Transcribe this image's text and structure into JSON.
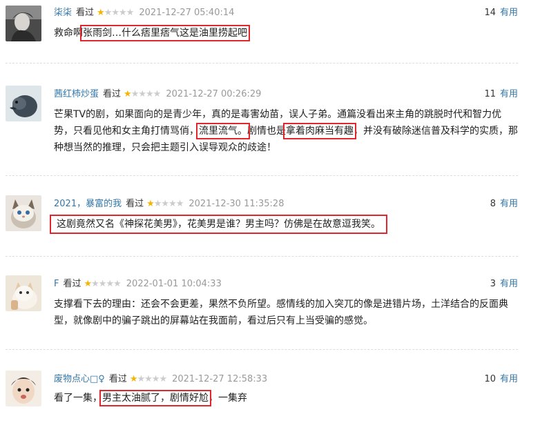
{
  "watched_label": "看过",
  "useful_label": "有用",
  "colors": {
    "link": "#3377aa",
    "star_on": "#f5b400",
    "star_off": "#cccccc",
    "highlight": "#e0262d"
  },
  "comments": [
    {
      "user": "柒柒",
      "stars": 1,
      "time": "2021-12-27 05:40:14",
      "votes": "14",
      "text_parts": [
        "救命啊",
        "张雨剑…什么痞里痞气这是油里捞起吧",
        ""
      ]
    },
    {
      "user": "茜红柿炒蛋",
      "stars": 1,
      "time": "2021-12-27 00:26:29",
      "votes": "11",
      "text_parts": [
        "芒果TV的剧，如果面向的是青少年，真的是毒害幼苗，误人子弟。通篇没看出来主角的跳脱时代和智力优势，只看见他和女主角打情骂俏，",
        "流里流气。",
        "剧情也是",
        "拿着肉麻当有趣",
        "，并没有破除迷信普及科学的实质，那种想当然的推理，只会把主题引入误导观众的歧途！"
      ]
    },
    {
      "user": "2021，暴富的我",
      "stars": 1,
      "time": "2021-12-30 11:35:28",
      "votes": "8",
      "text_parts": [
        "",
        "这剧竟然又名《神探花美男》，花美男是谁？男主吗？仿佛是在故意逗我笑。",
        ""
      ]
    },
    {
      "user": "F",
      "stars": 1,
      "time": "2022-01-01 10:04:33",
      "votes": "3",
      "text_parts": [
        "支撑看下去的理由：还会不会更差，果然不负所望。感情线的加入突兀的像是进错片场，土洋结合的反面典型，就像剧中的骗子跳出的屏幕站在我面前，看过后只有上当受骗的感觉。"
      ]
    },
    {
      "user": "废物点心□♀",
      "stars": 1,
      "time": "2021-12-27 12:58:33",
      "votes": "10",
      "text_parts": [
        "看了一集，",
        "男主太油腻了，剧情好尬",
        "，一集弃"
      ]
    }
  ]
}
